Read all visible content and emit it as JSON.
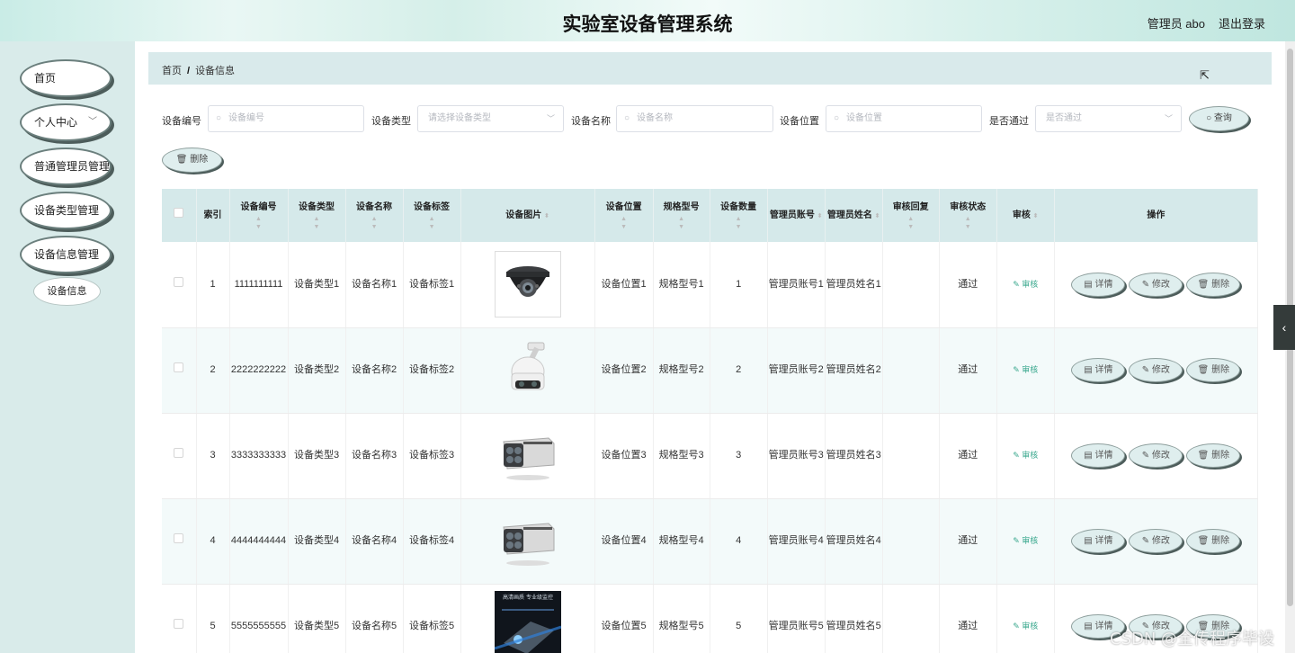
{
  "header": {
    "title": "实验室设备管理系统",
    "admin": "管理员 abo",
    "logout": "退出登录"
  },
  "sidebar": {
    "items": [
      {
        "label": "首页"
      },
      {
        "label": "个人中心"
      },
      {
        "label": "普通管理员管理"
      },
      {
        "label": "设备类型管理"
      },
      {
        "label": "设备信息管理"
      }
    ],
    "sub_item": "设备信息"
  },
  "breadcrumb": {
    "home": "首页",
    "sep": "/",
    "current": "设备信息"
  },
  "filters": {
    "code_label": "设备编号",
    "code_placeholder": "设备编号",
    "type_label": "设备类型",
    "type_placeholder": "请选择设备类型",
    "name_label": "设备名称",
    "name_placeholder": "设备名称",
    "location_label": "设备位置",
    "location_placeholder": "设备位置",
    "approved_label": "是否通过",
    "approved_placeholder": "是否通过",
    "query_button": "查询",
    "delete_button": "删除"
  },
  "table": {
    "headers": {
      "index": "索引",
      "code": "设备编号",
      "type": "设备类型",
      "name": "设备名称",
      "tag": "设备标签",
      "image": "设备图片",
      "location": "设备位置",
      "spec": "规格型号",
      "qty": "设备数量",
      "admin_account": "管理员账号",
      "admin_name": "管理员姓名",
      "reply": "审核回复",
      "status": "审核状态",
      "audit": "审核",
      "actions": "操作"
    },
    "rows": [
      {
        "index": "1",
        "code": "1111111111",
        "type": "设备类型1",
        "name": "设备名称1",
        "tag": "设备标签1",
        "location": "设备位置1",
        "spec": "规格型号1",
        "qty": "1",
        "admin_account": "管理员账号1",
        "admin_name": "管理员姓名1",
        "reply": "",
        "status": "通过"
      },
      {
        "index": "2",
        "code": "2222222222",
        "type": "设备类型2",
        "name": "设备名称2",
        "tag": "设备标签2",
        "location": "设备位置2",
        "spec": "规格型号2",
        "qty": "2",
        "admin_account": "管理员账号2",
        "admin_name": "管理员姓名2",
        "reply": "",
        "status": "通过"
      },
      {
        "index": "3",
        "code": "3333333333",
        "type": "设备类型3",
        "name": "设备名称3",
        "tag": "设备标签3",
        "location": "设备位置3",
        "spec": "规格型号3",
        "qty": "3",
        "admin_account": "管理员账号3",
        "admin_name": "管理员姓名3",
        "reply": "",
        "status": "通过"
      },
      {
        "index": "4",
        "code": "4444444444",
        "type": "设备类型4",
        "name": "设备名称4",
        "tag": "设备标签4",
        "location": "设备位置4",
        "spec": "规格型号4",
        "qty": "4",
        "admin_account": "管理员账号4",
        "admin_name": "管理员姓名4",
        "reply": "",
        "status": "通过"
      },
      {
        "index": "5",
        "code": "5555555555",
        "type": "设备类型5",
        "name": "设备名称5",
        "tag": "设备标签5",
        "location": "设备位置5",
        "spec": "规格型号5",
        "qty": "5",
        "admin_account": "管理员账号5",
        "admin_name": "管理员姓名5",
        "reply": "",
        "status": "通过"
      }
    ],
    "audit_link": "审核",
    "detail_button": "详情",
    "edit_button": "修改",
    "delete_button": "删除",
    "row5_image_text": "高清画质 专业级监控"
  },
  "watermark": "CSDN @全传程序毕设",
  "colors": {
    "accent": "#3aa88e",
    "header_bg": "#d5e9ea",
    "sidebar_bg": "#d9ebea"
  }
}
